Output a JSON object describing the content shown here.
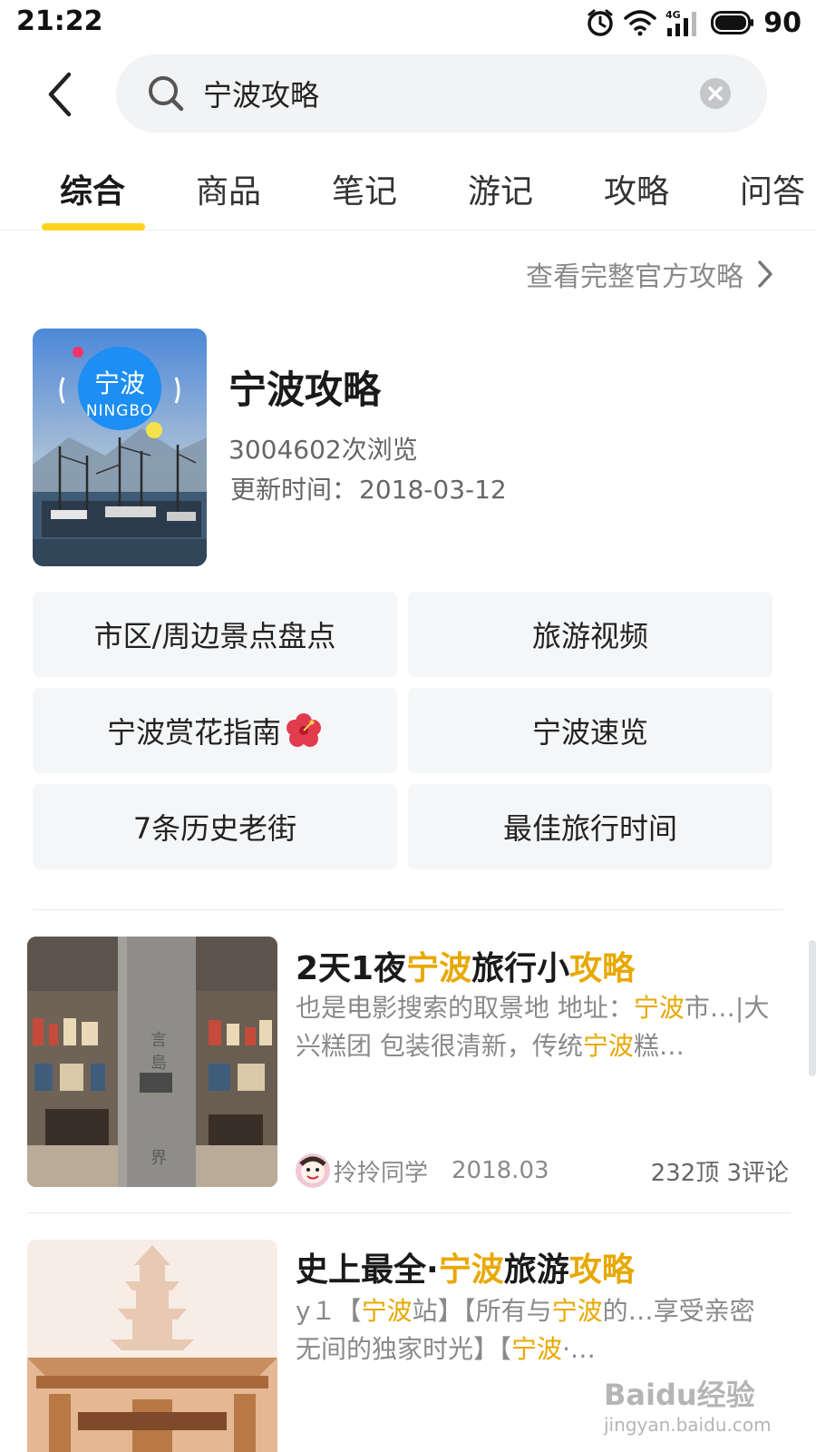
{
  "status_bar": {
    "time": "21:22",
    "network": "4G",
    "battery": "90"
  },
  "search": {
    "query": "宁波攻略"
  },
  "tabs": [
    {
      "label": "综合",
      "active": true
    },
    {
      "label": "商品"
    },
    {
      "label": "笔记"
    },
    {
      "label": "游记"
    },
    {
      "label": "攻略"
    },
    {
      "label": "问答"
    }
  ],
  "guide_link": {
    "label": "查看完整官方攻略"
  },
  "guide": {
    "cover_text": "宁波",
    "cover_subtext": "NINGBO",
    "title": "宁波攻略",
    "views": "3004602次浏览",
    "update_label": "更新时间：",
    "update_date": "2018-03-12"
  },
  "topics": [
    {
      "label": "市区/周边景点盘点"
    },
    {
      "label": "旅游视频"
    },
    {
      "label": "宁波赏花指南"
    },
    {
      "label": "宁波速览"
    },
    {
      "label": "7条历史老街"
    },
    {
      "label": "最佳旅行时间"
    }
  ],
  "articles": [
    {
      "title_parts": [
        "2天1夜",
        "宁波",
        "旅行小",
        "攻略"
      ],
      "snippet_line1": [
        "也是电影搜索的取景地 地址：",
        "宁波",
        "市…|大"
      ],
      "snippet_line2": [
        "兴糕团 包装很清新，传统",
        "宁波",
        "糕…"
      ],
      "author": "拎拎同学",
      "date": "2018.03",
      "stats": "232顶 3评论",
      "image_text": [
        "言",
        "島",
        "界"
      ]
    },
    {
      "title_parts": [
        "史上最全·",
        "宁波",
        "旅游",
        "攻略"
      ],
      "snippet_line1": [
        "y１【",
        "宁波",
        "站】【所有与",
        "宁波",
        "的…享受亲密"
      ],
      "snippet_line2": [
        "无间的独家时光】【",
        "宁波",
        "·…"
      ]
    }
  ],
  "watermark": {
    "logo": "Baidu经验",
    "url": "jingyan.baidu.com"
  },
  "colors": {
    "accent": "#ffd21f",
    "highlight": "#e8a800",
    "tile_bg": "#f4f6f8"
  },
  "icons": [
    "clock-icon",
    "wifi-icon",
    "signal-icon",
    "battery-icon",
    "back-arrow-icon",
    "search-icon",
    "clear-icon",
    "chevron-right-icon",
    "flower-emoji-icon"
  ]
}
